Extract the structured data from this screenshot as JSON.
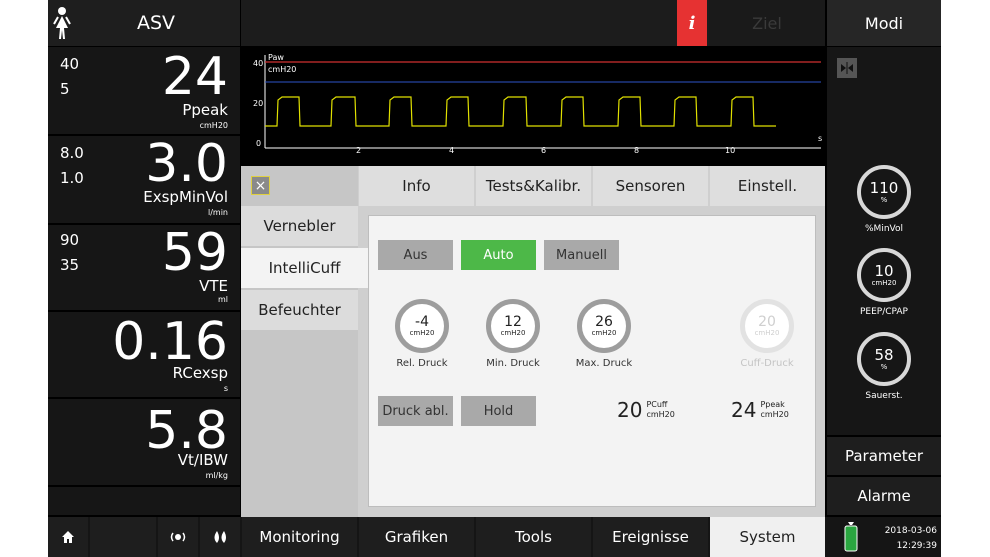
{
  "mode": "ASV",
  "top": {
    "ziel": "Ziel",
    "modi": "Modi",
    "info_icon": "i"
  },
  "left": [
    {
      "hi": "40",
      "lo": "5",
      "value": "24",
      "label": "Ppeak",
      "unit": "cmH20"
    },
    {
      "hi": "8.0",
      "lo": "1.0",
      "value": "3.0",
      "label": "ExspMinVol",
      "unit": "l/min"
    },
    {
      "hi": "90",
      "lo": "35",
      "value": "59",
      "label": "VTE",
      "unit": "ml"
    },
    {
      "value": "0.16",
      "label": "RCexsp",
      "unit": "s"
    },
    {
      "value": "5.8",
      "label": "Vt/IBW",
      "unit": "ml/kg"
    }
  ],
  "waveform": {
    "title": "Paw",
    "unit": "cmH20",
    "x_unit": "s",
    "y_ticks": [
      "40",
      "20",
      "0"
    ],
    "x_ticks": [
      "2",
      "4",
      "6",
      "8",
      "10"
    ]
  },
  "panel": {
    "close_icon": "×",
    "tabs": [
      "Info",
      "Tests&Kalibr.",
      "Sensoren",
      "Einstell."
    ],
    "side": [
      "Vernebler",
      "IntelliCuff",
      "Befeuchter"
    ],
    "mode_buttons": [
      "Aus",
      "Auto",
      "Manuell"
    ],
    "dials": [
      {
        "value": "-4",
        "unit": "cmH20",
        "label": "Rel. Druck"
      },
      {
        "value": "12",
        "unit": "cmH20",
        "label": "Min. Druck"
      },
      {
        "value": "26",
        "unit": "cmH20",
        "label": "Max. Druck"
      },
      {
        "value": "20",
        "unit": "cmH20",
        "label": "Cuff-Druck"
      }
    ],
    "action_buttons": [
      "Druck abl.",
      "Hold"
    ],
    "readouts": [
      {
        "value": "20",
        "label": "PCuff",
        "unit": "cmH20"
      },
      {
        "value": "24",
        "label": "Ppeak",
        "unit": "cmH20"
      }
    ]
  },
  "right": {
    "dials": [
      {
        "value": "110",
        "unit": "%",
        "label": "%MinVol"
      },
      {
        "value": "10",
        "unit": "cmH20",
        "label": "PEEP/CPAP"
      },
      {
        "value": "58",
        "unit": "%",
        "label": "Sauerst."
      }
    ],
    "parameter": "Parameter",
    "alarme": "Alarme",
    "date": "2018-03-06",
    "time": "12:29:39"
  },
  "bottom": {
    "tabs": [
      "Monitoring",
      "Grafiken",
      "Tools",
      "Ereignisse",
      "System"
    ]
  },
  "colors": {
    "info": "#e63232",
    "accent_green": "#4db848",
    "trace": "#e0e000",
    "alarm_line": "#d03030",
    "blue_line": "#2e55c8"
  }
}
